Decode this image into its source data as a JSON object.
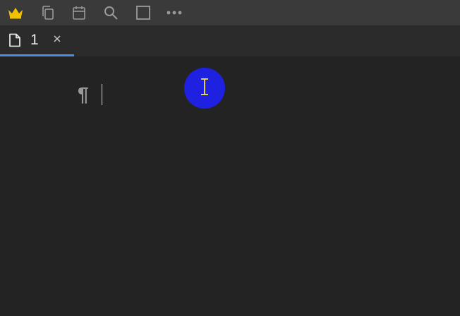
{
  "toolbar": {
    "buttons": [
      {
        "name": "crown-icon",
        "color": "#f2c200"
      },
      {
        "name": "copy-icon"
      },
      {
        "name": "calendar-icon"
      },
      {
        "name": "search-icon"
      },
      {
        "name": "square-icon"
      },
      {
        "name": "more-icon"
      }
    ]
  },
  "tabs": [
    {
      "label": "1",
      "icon": "document-icon",
      "active": true
    }
  ],
  "editor": {
    "paragraph_mark": "¶"
  },
  "colors": {
    "toolbar_bg": "#3a3a3a",
    "editor_bg": "#232323",
    "tab_accent": "#4a8fe7",
    "cursor_highlight": "#1f21e0",
    "cursor_icon": "#f5e04a"
  }
}
